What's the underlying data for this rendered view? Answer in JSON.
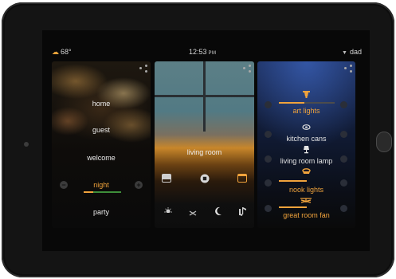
{
  "status": {
    "temperature": "68°",
    "time": "12:53",
    "ampm": "PM",
    "user": "dad"
  },
  "scenes": {
    "items": [
      "home",
      "guest",
      "welcome",
      "night",
      "party"
    ],
    "active": "night",
    "active_level": 0.25
  },
  "room": {
    "name": "living room"
  },
  "lights": [
    {
      "name": "art lights",
      "on": true,
      "icon": "spotlight-icon",
      "level": 0.45
    },
    {
      "name": "kitchen cans",
      "on": false,
      "icon": "can-light-icon"
    },
    {
      "name": "living room lamp",
      "on": false,
      "icon": "lamp-icon"
    },
    {
      "name": "nook lights",
      "on": true,
      "icon": "pendant-icon",
      "level": 0.5
    },
    {
      "name": "great room fan",
      "on": true,
      "icon": "fan-icon",
      "level": 0.5
    }
  ],
  "colors": {
    "accent": "#f0a33c",
    "level_green": "#3e8e3a",
    "background": "#080808"
  }
}
